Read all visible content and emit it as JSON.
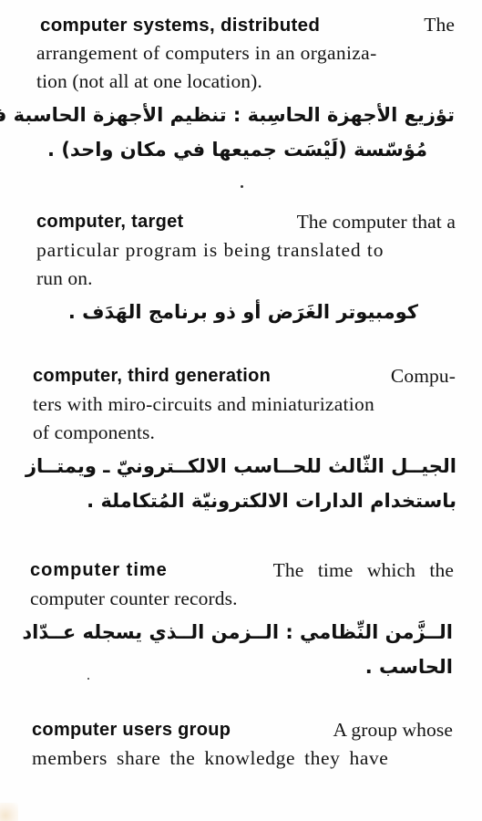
{
  "entries": [
    {
      "term": "computer systems, distributed",
      "definition_lines": [
        "The",
        "arrangement of computers in an organiza-",
        "tion (not all at one location)."
      ],
      "arabic_lines": [
        "تؤزيع الأجهزة الحاسِبة : تنظيم الأجهزة الحاسبة في",
        "مُؤسّسة (لَيْسَت جميعها في مكان واحد) ."
      ]
    },
    {
      "term": "computer, target",
      "definition_lines": [
        "The computer that a",
        "particular program is being translated to",
        "run on."
      ],
      "arabic_lines": [
        "كومبيوتر الغَرَض أو ذو برنامج الهَدَف ."
      ]
    },
    {
      "term": "computer, third generation",
      "definition_lines": [
        "Compu-",
        "ters with miro-circuits and miniaturization",
        "of components."
      ],
      "arabic_lines": [
        "الجيــل الثّالث للحــاسب الالكــترونيّ ـ ويمتــاز",
        "باستخدام الدارات الالكترونيّة المُتكاملة ."
      ]
    },
    {
      "term": "computer time",
      "definition_lines": [
        "The time which the",
        "computer counter records."
      ],
      "arabic_lines": [
        "الــزَّمن النِّظامي : الــزمن الــذي يسجله عــدّاد",
        "الحاسب ."
      ]
    },
    {
      "term": "computer users group",
      "definition_lines": [
        "A group whose",
        "members share the knowledge they have"
      ],
      "arabic_lines": []
    }
  ]
}
